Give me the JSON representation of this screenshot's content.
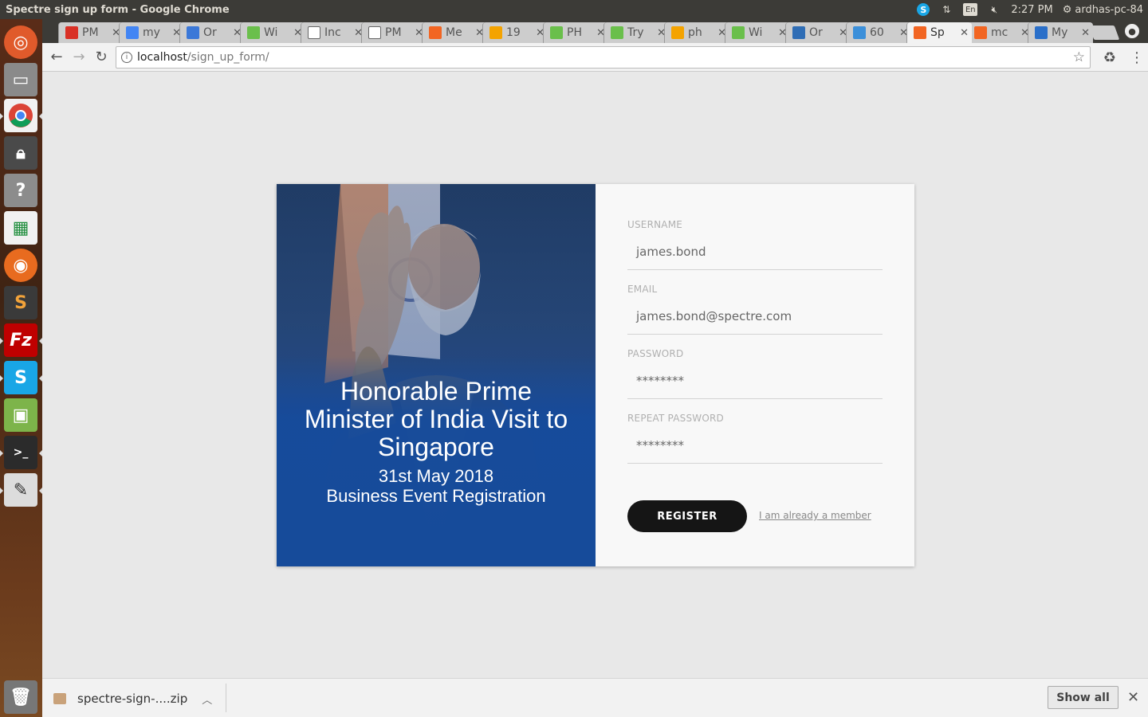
{
  "system": {
    "window_title": "Spectre sign up form - Google Chrome",
    "keyboard": "En",
    "time": "2:27 PM",
    "user": "ardhas-pc-84"
  },
  "tabs": [
    {
      "label": "PM",
      "icon": "gmail-icon",
      "color": "#d93025"
    },
    {
      "label": "my",
      "icon": "google-icon",
      "color": "#4285f4"
    },
    {
      "label": "Or",
      "icon": "chart-icon",
      "color": "#3b78d8"
    },
    {
      "label": "Wi",
      "icon": "wix-icon",
      "color": "#6abf4b"
    },
    {
      "label": "Inc",
      "icon": "document-icon",
      "color": "#ffffff"
    },
    {
      "label": "PM",
      "icon": "document-icon",
      "color": "#ffffff"
    },
    {
      "label": "Me",
      "icon": "xampp-icon",
      "color": "#f26522"
    },
    {
      "label": "19",
      "icon": "pma-icon",
      "color": "#f4a300"
    },
    {
      "label": "PH",
      "icon": "wix-icon",
      "color": "#6abf4b"
    },
    {
      "label": "Try",
      "icon": "wix-icon",
      "color": "#6abf4b"
    },
    {
      "label": "ph",
      "icon": "pma-icon",
      "color": "#f4a300"
    },
    {
      "label": "Wi",
      "icon": "wix-icon",
      "color": "#6abf4b"
    },
    {
      "label": "Or",
      "icon": "r-icon",
      "color": "#2f6db5"
    },
    {
      "label": "60",
      "icon": "f-icon",
      "color": "#3b8fd9"
    },
    {
      "label": "Sp",
      "icon": "xampp-icon",
      "color": "#f26522",
      "active": true
    },
    {
      "label": "mc",
      "icon": "xampp-icon",
      "color": "#f26522"
    },
    {
      "label": "My",
      "icon": "u-icon",
      "color": "#2a6fc9"
    }
  ],
  "address": {
    "host": "localhost",
    "path": "/sign_up_form/"
  },
  "hero": {
    "headline": "Honorable Prime Minister of India Visit to Singapore",
    "date": "31st May 2018",
    "subtitle": "Business Event Registration"
  },
  "form": {
    "username_label": "USERNAME",
    "username_value": "james.bond",
    "email_label": "EMAIL",
    "email_value": "james.bond@spectre.com",
    "password_label": "PASSWORD",
    "password_value": "********",
    "repeat_label": "REPEAT PASSWORD",
    "repeat_value": "********",
    "register_label": "REGISTER",
    "member_link": "I am already a member"
  },
  "downloads": {
    "file": "spectre-sign-....zip",
    "show_all": "Show all"
  },
  "colors": {
    "hero_blue": "#164b9a",
    "button": "#151515"
  }
}
